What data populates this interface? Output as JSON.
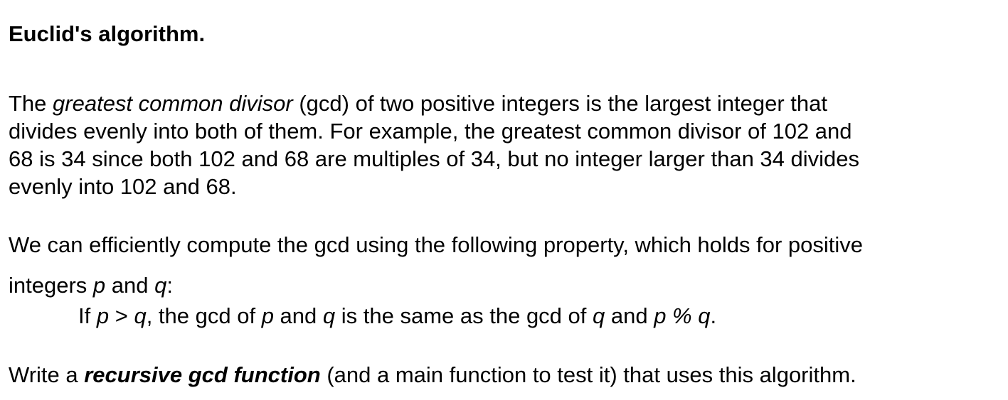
{
  "title": "Euclid's algorithm.",
  "paragraph1": {
    "line1": {
      "pre": "The ",
      "term": "greatest common divisor",
      "post": " (gcd) of two positive integers is the largest integer that"
    },
    "line2": "divides evenly into both of them. For example, the greatest common divisor of 102 and",
    "line3": "68 is 34 since both 102 and 68 are multiples of 34, but no integer larger than 34 divides",
    "line4": "evenly into 102 and 68."
  },
  "paragraph2": {
    "line1": "We can efficiently compute the gcd using the following property, which holds for positive",
    "line2": {
      "pre": "integers ",
      "var_p": "p",
      "mid": " and ",
      "var_q": "q",
      "post": ":"
    }
  },
  "rule": {
    "t1": "If ",
    "v1": "p",
    "t2": " > ",
    "v2": "q",
    "t3": ", the gcd of ",
    "v3": "p",
    "t4": " and ",
    "v4": "q",
    "t5": " is the same as the gcd of ",
    "v5": "q",
    "t6": " and ",
    "v6": "p % q",
    "t7": "."
  },
  "paragraph3": {
    "pre": "Write a ",
    "emphasis": "recursive gcd function",
    "post": " (and a main function to test it) that uses this algorithm."
  }
}
